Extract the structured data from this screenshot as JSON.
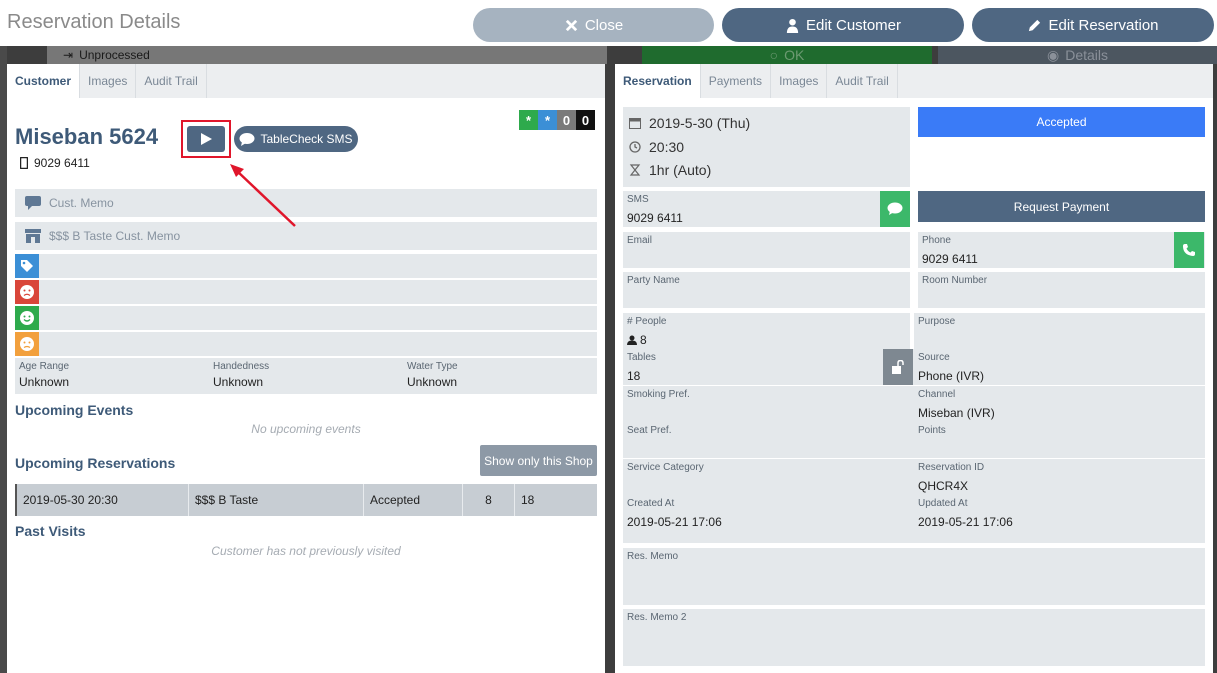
{
  "header": {
    "title": "Reservation Details",
    "close_label": "Close",
    "edit_customer_label": "Edit Customer",
    "edit_reservation_label": "Edit Reservation"
  },
  "backdrop": {
    "unprocessed": "Unprocessed",
    "ok": "OK",
    "details": "Details"
  },
  "left": {
    "tabs": [
      "Customer",
      "Images",
      "Audit Trail"
    ],
    "customer_name": "Miseban 5624",
    "phone": "9029 6411",
    "sms_button": "TableCheck SMS",
    "badges": [
      "*",
      "*",
      "0",
      "0"
    ],
    "cust_memo_placeholder": "Cust. Memo",
    "shop_memo_placeholder": "$$$ B Taste Cust. Memo",
    "age_label": "Age Range",
    "age_value": "Unknown",
    "hand_label": "Handedness",
    "hand_value": "Unknown",
    "water_label": "Water Type",
    "water_value": "Unknown",
    "upcoming_events_title": "Upcoming Events",
    "upcoming_events_empty": "No upcoming events",
    "upcoming_res_title": "Upcoming Reservations",
    "show_only_shop": "Show only this Shop",
    "reservation_row": [
      "2019-05-30 20:30",
      "$$$ B Taste",
      "Accepted",
      "8",
      "18"
    ],
    "past_visits_title": "Past Visits",
    "past_visits_empty": "Customer has not previously visited"
  },
  "right": {
    "tabs": [
      "Reservation",
      "Payments",
      "Images",
      "Audit Trail"
    ],
    "date": "2019-5-30 (Thu)",
    "time": "20:30",
    "duration": "1hr (Auto)",
    "status_button": "Accepted",
    "sms_label": "SMS",
    "sms_value": "9029 6411",
    "request_payment": "Request Payment",
    "email_label": "Email",
    "phone_label": "Phone",
    "phone_value": "9029 6411",
    "party_label": "Party Name",
    "room_label": "Room Number",
    "people_label": "# People",
    "people_value": "8",
    "purpose_label": "Purpose",
    "tables_label": "Tables",
    "tables_value": "18",
    "source_label": "Source",
    "source_value": "Phone (IVR)",
    "smoking_label": "Smoking Pref.",
    "channel_label": "Channel",
    "channel_value": "Miseban (IVR)",
    "seat_label": "Seat Pref.",
    "points_label": "Points",
    "service_label": "Service Category",
    "resid_label": "Reservation ID",
    "resid_value": "QHCR4X",
    "created_label": "Created At",
    "created_value": "2019-05-21 17:06",
    "updated_label": "Updated At",
    "updated_value": "2019-05-21 17:06",
    "memo_label": "Res. Memo",
    "memo2_label": "Res. Memo 2"
  },
  "colors": {
    "primary": "#4f6782",
    "accent_blue": "#3a7bf7",
    "green": "#3cb86a",
    "highlight_red": "#e0162b"
  }
}
